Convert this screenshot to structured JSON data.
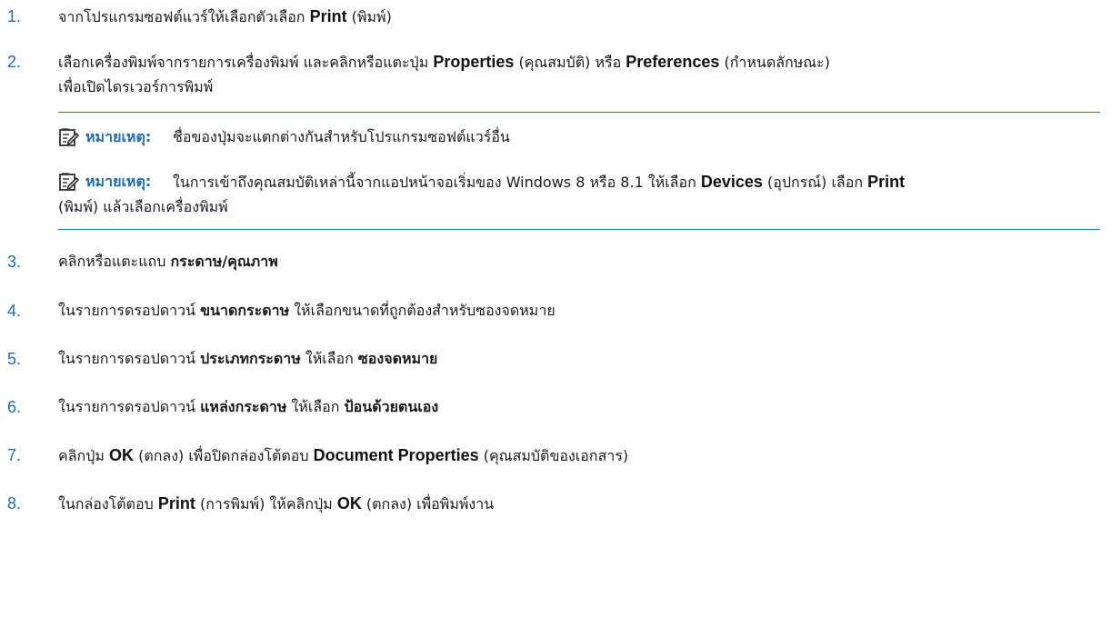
{
  "steps": [
    {
      "number": "1.",
      "parts": [
        "จากโปรแกรมซอฟต์แวร์ให้เลือกตัวเลือก ",
        "Print",
        " (พิมพ์)"
      ]
    },
    {
      "number": "2.",
      "line1": [
        "เลือกเครื่องพิมพ์จากรายการเครื่องพิมพ์ และคลิกหรือแตะปุ่ม ",
        "Properties",
        " (คุณสมบัติ) หรือ ",
        "Preferences",
        " (กำหนดลักษณะ)"
      ],
      "line2": "เพื่อเปิดไดรเวอร์การพิมพ์"
    },
    {
      "number": "3.",
      "parts": [
        "คลิกหรือแตะแถบ ",
        "กระดาษ/คุณภาพ"
      ]
    },
    {
      "number": "4.",
      "parts": [
        "ในรายการดรอปดาวน์ ",
        "ขนาดกระดาษ",
        " ให้เลือกขนาดที่ถูกต้องสำหรับซองจดหมาย"
      ]
    },
    {
      "number": "5.",
      "parts": [
        "ในรายการดรอปดาวน์ ",
        "ประเภทกระดาษ",
        " ให้เลือก ",
        "ซองจดหมาย"
      ]
    },
    {
      "number": "6.",
      "parts": [
        "ในรายการดรอปดาวน์ ",
        "แหล่งกระดาษ",
        " ให้เลือก ",
        "ป้อนด้วยตนเอง"
      ]
    },
    {
      "number": "7.",
      "parts": [
        "คลิกปุ่ม ",
        "OK",
        " (ตกลง) เพื่อปิดกล่องโต้ตอบ ",
        "Document Properties",
        " (คุณสมบัติของเอกสาร)"
      ]
    },
    {
      "number": "8.",
      "parts": [
        "ในกล่องโต้ตอบ ",
        "Print",
        " (การพิมพ์) ให้คลิกปุ่ม ",
        "OK",
        " (ตกลง) เพื่อพิมพ์งาน"
      ]
    }
  ],
  "notes": [
    {
      "label": "หมายเหตุ:",
      "body": "ชื่อของปุ่มจะแตกต่างกันสำหรับโปรแกรมซอฟต์แวร์อื่น"
    },
    {
      "label": "หมายเหตุ:",
      "body_parts": [
        "ในการเข้าถึงคุณสมบัติเหล่านี้จากแอปหน้าจอเริ่มของ Windows 8 หรือ 8.1 ให้เลือก ",
        "Devices",
        " (อุปกรณ์) เลือก ",
        "Print"
      ],
      "body_line2": "(พิมพ์) แล้วเลือกเครื่องพิมพ์"
    }
  ],
  "colors": {
    "accent": "#1f6db4",
    "rule": "#2a7ec2"
  },
  "icons": {
    "note": "note-pencil-icon"
  }
}
